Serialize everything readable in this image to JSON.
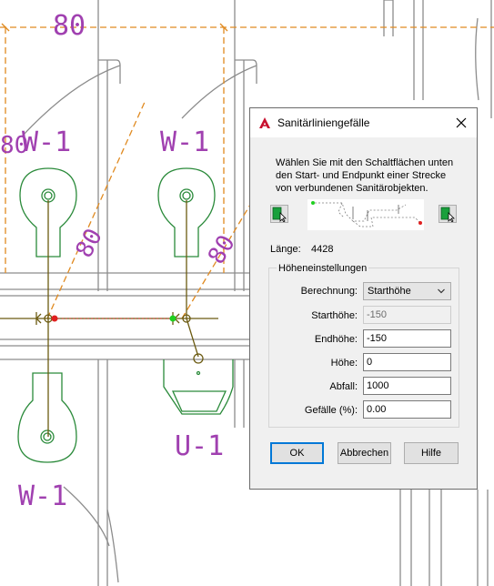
{
  "drawing": {
    "dimension_top": "80",
    "dimension_left": "80",
    "dimension_diag_1": "80",
    "dimension_diag_2": "80",
    "label_w1_a": "W-1",
    "label_w1_b": "W-1",
    "label_w1_c": "W-1",
    "label_u1": "U-1",
    "colors": {
      "walls": "#909090",
      "fixtures": "#2a8a3a",
      "dimensions": "#e08a20",
      "text": "#a040b0",
      "pipe": "#6b5a10",
      "start_point": "#e02020",
      "end_point": "#20d020"
    }
  },
  "dialog": {
    "app_icon": "autocad-a-icon",
    "title": "Sanitärliniengefälle",
    "close_icon": "close-x-icon",
    "instruction": "Wählen Sie mit den Schaltflächen unten den Start- und Endpunkt einer Strecke von verbundenen Sanitärobjekten.",
    "pick_start_icon": "pick-point-icon",
    "pick_end_icon": "pick-point-icon",
    "length_label": "Länge:",
    "length_value": "4428",
    "group_label": "Höheneinstellungen",
    "fields": {
      "calc_label": "Berechnung:",
      "calc_value": "Starthöhe",
      "start_label": "Starthöhe:",
      "start_value": "-150",
      "end_label": "Endhöhe:",
      "end_value": "-150",
      "height_label": "Höhe:",
      "height_value": "0",
      "drop_label": "Abfall:",
      "drop_value": "1000",
      "slope_label": "Gefälle (%):",
      "slope_value": "0.00"
    },
    "buttons": {
      "ok": "OK",
      "cancel": "Abbrechen",
      "help": "Hilfe"
    }
  }
}
